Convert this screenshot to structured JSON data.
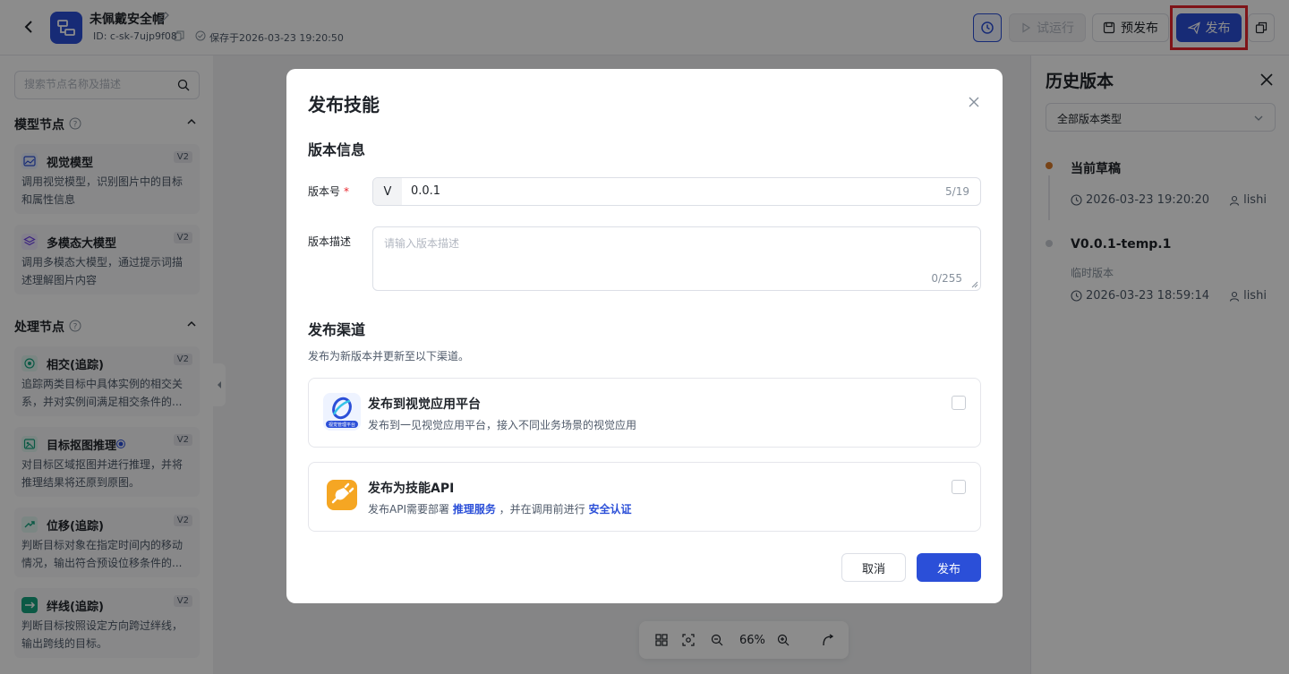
{
  "header": {
    "title": "未佩戴安全帽",
    "id_text": "ID: c-sk-7ujp9f08",
    "saved_text": "保存于2026-03-23 19:20:50",
    "trial_label": "试运行",
    "prepublish_label": "预发布",
    "publish_label": "发布"
  },
  "left": {
    "search_placeholder": "搜索节点名称及描述",
    "sections": [
      {
        "title": "模型节点",
        "nodes": [
          {
            "name": "视觉模型",
            "badge": "V2",
            "desc": "调用视觉模型，识别图片中的目标和属性信息"
          },
          {
            "name": "多模态大模型",
            "badge": "V2",
            "desc": "调用多模态大模型，通过提示词描述理解图片内容"
          }
        ]
      },
      {
        "title": "处理节点",
        "nodes": [
          {
            "name": "相交(追踪)",
            "badge": "V2",
            "desc": "追踪两类目标中具体实例的相交关系，并对实例间满足相交条件的..."
          },
          {
            "name": "目标抠图推理",
            "badge": "V2",
            "desc": "对目标区域抠图并进行推理，并将推理结果将还原到原图。"
          },
          {
            "name": "位移(追踪)",
            "badge": "V2",
            "desc": "判断目标对象在指定时间内的移动情况，输出符合预设位移条件的..."
          },
          {
            "name": "绊线(追踪)",
            "badge": "V2",
            "desc": "判断目标按照设定方向跨过绊线，输出跨线的目标。"
          }
        ]
      }
    ]
  },
  "right": {
    "title": "历史版本",
    "filter_value": "全部版本类型",
    "versions": [
      {
        "name": "当前草稿",
        "sub": "",
        "time": "2026-03-23 19:20:20",
        "user": "lishi",
        "dot_color": "#d97a2b"
      },
      {
        "name": "V0.0.1-temp.1",
        "sub": "临时版本",
        "time": "2026-03-23 18:59:14",
        "user": "lishi",
        "dot_color": "#c9cdd4"
      }
    ]
  },
  "zoom": {
    "level": "66%"
  },
  "modal": {
    "title": "发布技能",
    "version_section": "版本信息",
    "version_label": "版本号",
    "version_prefix": "V",
    "version_value": "0.0.1",
    "version_count": "5/19",
    "desc_label": "版本描述",
    "desc_placeholder": "请输入版本描述",
    "desc_count": "0/255",
    "channel_section": "发布渠道",
    "channel_hint": "发布为新版本并更新至以下渠道。",
    "channels": [
      {
        "title": "发布到视觉应用平台",
        "desc": "发布到一见视觉应用平台，接入不同业务场景的视觉应用",
        "logo_text": "视觉管理平台"
      },
      {
        "title": "发布为技能API",
        "desc_prefix": "发布API需要部署",
        "link1": "推理服务",
        "desc_mid": "，并在调用前进行",
        "link2": "安全认证"
      }
    ],
    "cancel_label": "取消",
    "publish_label": "发布"
  },
  "colors": {
    "primary": "#2b4fd8",
    "highlight": "#e8262d",
    "draft_dot": "#d97a2b"
  }
}
